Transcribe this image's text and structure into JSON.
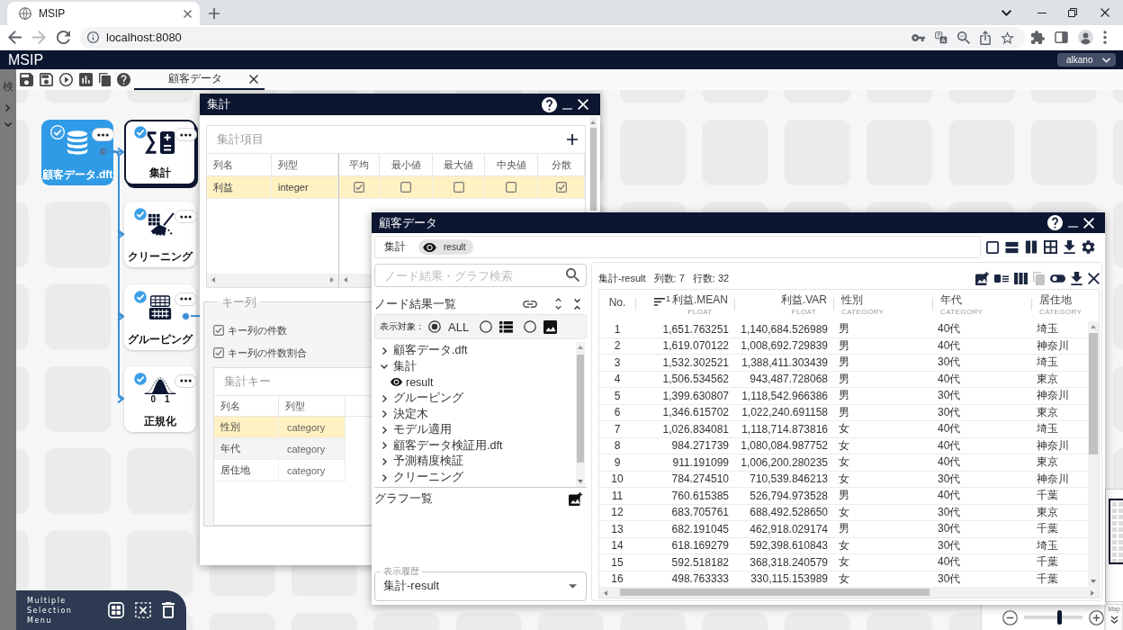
{
  "browser": {
    "tab_title": "MSIP",
    "address": "localhost:8080"
  },
  "app": {
    "title": "MSIP",
    "user": "alkano"
  },
  "sidebar": {
    "label": "検"
  },
  "editor_tabs": [
    {
      "label": "顧客データ",
      "selected": true
    }
  ],
  "canvas": {
    "nodes": [
      {
        "kind": "dataset",
        "label": "顧客データ.dft",
        "selected": false,
        "done": true,
        "output_port": true,
        "connected": false
      },
      {
        "kind": "aggregate",
        "label": "集計",
        "selected": true,
        "done": true,
        "output_port": false,
        "connected": true
      },
      {
        "kind": "cleaning",
        "label": "クリーニング",
        "selected": false,
        "done": true,
        "output_port": false,
        "connected": true
      },
      {
        "kind": "grouping",
        "label": "グルーピング",
        "selected": false,
        "done": true,
        "output_port": true,
        "connected": true
      },
      {
        "kind": "normalize",
        "label": "正規化",
        "selected": false,
        "done": true,
        "output_port": false,
        "connected": true,
        "axis_labels": [
          "0",
          "1"
        ]
      }
    ]
  },
  "selection_menu": {
    "title": "Multiple Selection Menu"
  },
  "aggregate_dialog": {
    "title": "集計",
    "items": {
      "title": "集計項目",
      "fixed_columns": [
        "列名",
        "列型"
      ],
      "stat_columns": [
        "平均",
        "最小値",
        "最大値",
        "中央値",
        "分散"
      ],
      "rows": [
        {
          "name": "利益",
          "type": "integer",
          "selected": true,
          "checks": [
            true,
            false,
            false,
            false,
            true
          ]
        }
      ]
    },
    "key_columns": {
      "legend": "キー列",
      "options": [
        {
          "label": "キー列の件数",
          "checked": true
        },
        {
          "label": "キー列の件数割合",
          "checked": true
        }
      ],
      "keys": {
        "title": "集計キー",
        "columns": [
          "列名",
          "列型"
        ],
        "rows": [
          {
            "name": "性別",
            "type": "category",
            "selected": true
          },
          {
            "name": "年代",
            "type": "category",
            "selected": false
          },
          {
            "name": "居住地",
            "type": "category",
            "selected": false
          }
        ]
      }
    }
  },
  "result_dialog": {
    "title": "顧客データ",
    "path": {
      "node": "集計",
      "result": "result"
    },
    "search": {
      "placeholder": "ノード結果・グラフ検索"
    },
    "node_results": {
      "title": "ノード結果一覧",
      "filter_label": "表示対象：",
      "filters": [
        {
          "kind": "all",
          "label": "ALL",
          "selected": true
        },
        {
          "kind": "table",
          "selected": false
        },
        {
          "kind": "image",
          "selected": false
        }
      ],
      "tree": [
        {
          "label": "顧客データ.dft",
          "expanded": false
        },
        {
          "label": "集計",
          "expanded": true,
          "children": [
            {
              "label": "result"
            }
          ]
        },
        {
          "label": "グルーピング",
          "expanded": false
        },
        {
          "label": "決定木",
          "expanded": false
        },
        {
          "label": "モデル適用",
          "expanded": false
        },
        {
          "label": "顧客データ検証用.dft",
          "expanded": false
        },
        {
          "label": "予測精度検証",
          "expanded": false
        },
        {
          "label": "クリーニング",
          "expanded": false
        }
      ]
    },
    "graphs": {
      "title": "グラフ一覧"
    },
    "history": {
      "label": "表示履歴",
      "value": "集計-result"
    },
    "table": {
      "title": "集計-result",
      "column_count": "列数: 7",
      "row_count": "行数: 32",
      "columns": [
        {
          "name": "No.",
          "kind": "index"
        },
        {
          "name": "利益.MEAN",
          "type": "FLOAT",
          "kind": "number",
          "sort_order": "1"
        },
        {
          "name": "利益.VAR",
          "type": "FLOAT",
          "kind": "number"
        },
        {
          "name": "性別",
          "type": "CATEGORY",
          "kind": "text"
        },
        {
          "name": "年代",
          "type": "CATEGORY",
          "kind": "text"
        },
        {
          "name": "居住地",
          "type": "CATEGORY",
          "kind": "text"
        }
      ],
      "rows": [
        [
          "1",
          "1,651.763251",
          "1,140,684.526989",
          "男",
          "40代",
          "埼玉"
        ],
        [
          "2",
          "1,619.070122",
          "1,008,692.729839",
          "男",
          "40代",
          "神奈川"
        ],
        [
          "3",
          "1,532.302521",
          "1,388,411.303439",
          "男",
          "30代",
          "埼玉"
        ],
        [
          "4",
          "1,506.534562",
          "943,487.728068",
          "男",
          "40代",
          "東京"
        ],
        [
          "5",
          "1,399.630807",
          "1,118,542.966386",
          "男",
          "30代",
          "神奈川"
        ],
        [
          "6",
          "1,346.615702",
          "1,022,240.691158",
          "男",
          "30代",
          "東京"
        ],
        [
          "7",
          "1,026.834081",
          "1,118,714.873816",
          "女",
          "40代",
          "埼玉"
        ],
        [
          "8",
          "984.271739",
          "1,080,084.987752",
          "女",
          "40代",
          "神奈川"
        ],
        [
          "9",
          "911.191099",
          "1,006,200.280235",
          "女",
          "40代",
          "東京"
        ],
        [
          "10",
          "784.274510",
          "710,539.846213",
          "女",
          "30代",
          "神奈川"
        ],
        [
          "11",
          "760.615385",
          "526,794.973528",
          "男",
          "40代",
          "千葉"
        ],
        [
          "12",
          "683.705761",
          "688,492.528650",
          "女",
          "30代",
          "東京"
        ],
        [
          "13",
          "682.191045",
          "462,918.029174",
          "男",
          "30代",
          "千葉"
        ],
        [
          "14",
          "618.169279",
          "592,398.610843",
          "女",
          "30代",
          "埼玉"
        ],
        [
          "15",
          "592.518182",
          "368,318.240579",
          "女",
          "40代",
          "千葉"
        ],
        [
          "16",
          "498.763333",
          "330,115.153989",
          "女",
          "30代",
          "千葉"
        ]
      ]
    }
  },
  "zoom": {
    "level": 0.6,
    "map_label": "Map"
  }
}
